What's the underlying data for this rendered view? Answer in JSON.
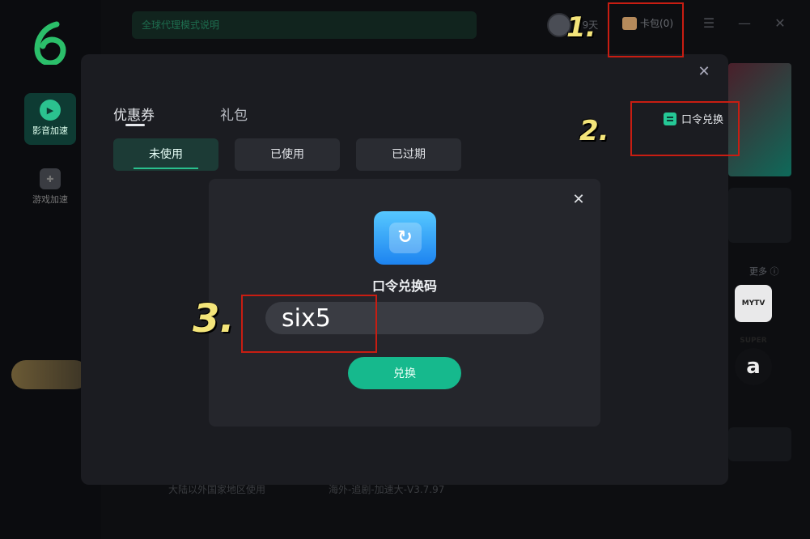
{
  "background": {
    "banner_text": "全球代理模式说明",
    "days_text": "79天",
    "wallet_label": "卡包(0)",
    "nav": [
      {
        "label": "影音加速",
        "icon": "play-icon"
      },
      {
        "label": "游戏加速",
        "icon": "gamepad-icon"
      }
    ],
    "more_label": "更多",
    "mytv_text": "MYTV SUPER",
    "amazon_text": "a",
    "footer_left": "大陆以外国家地区使用",
    "footer_right": "海外-追剧-加速大-V3.7.97"
  },
  "modal": {
    "tabs": [
      "优惠券",
      "礼包"
    ],
    "filters": [
      "未使用",
      "已使用",
      "已过期"
    ],
    "redeem_link": "口令兑换"
  },
  "dialog": {
    "title": "口令兑换码",
    "input_value": "six5",
    "confirm_label": "兑换"
  },
  "annotations": [
    "1.",
    "2.",
    "3."
  ],
  "colors": {
    "accent": "#16b98d",
    "annotation_border": "#c81d12",
    "annotation_number": "#f4e57a"
  }
}
